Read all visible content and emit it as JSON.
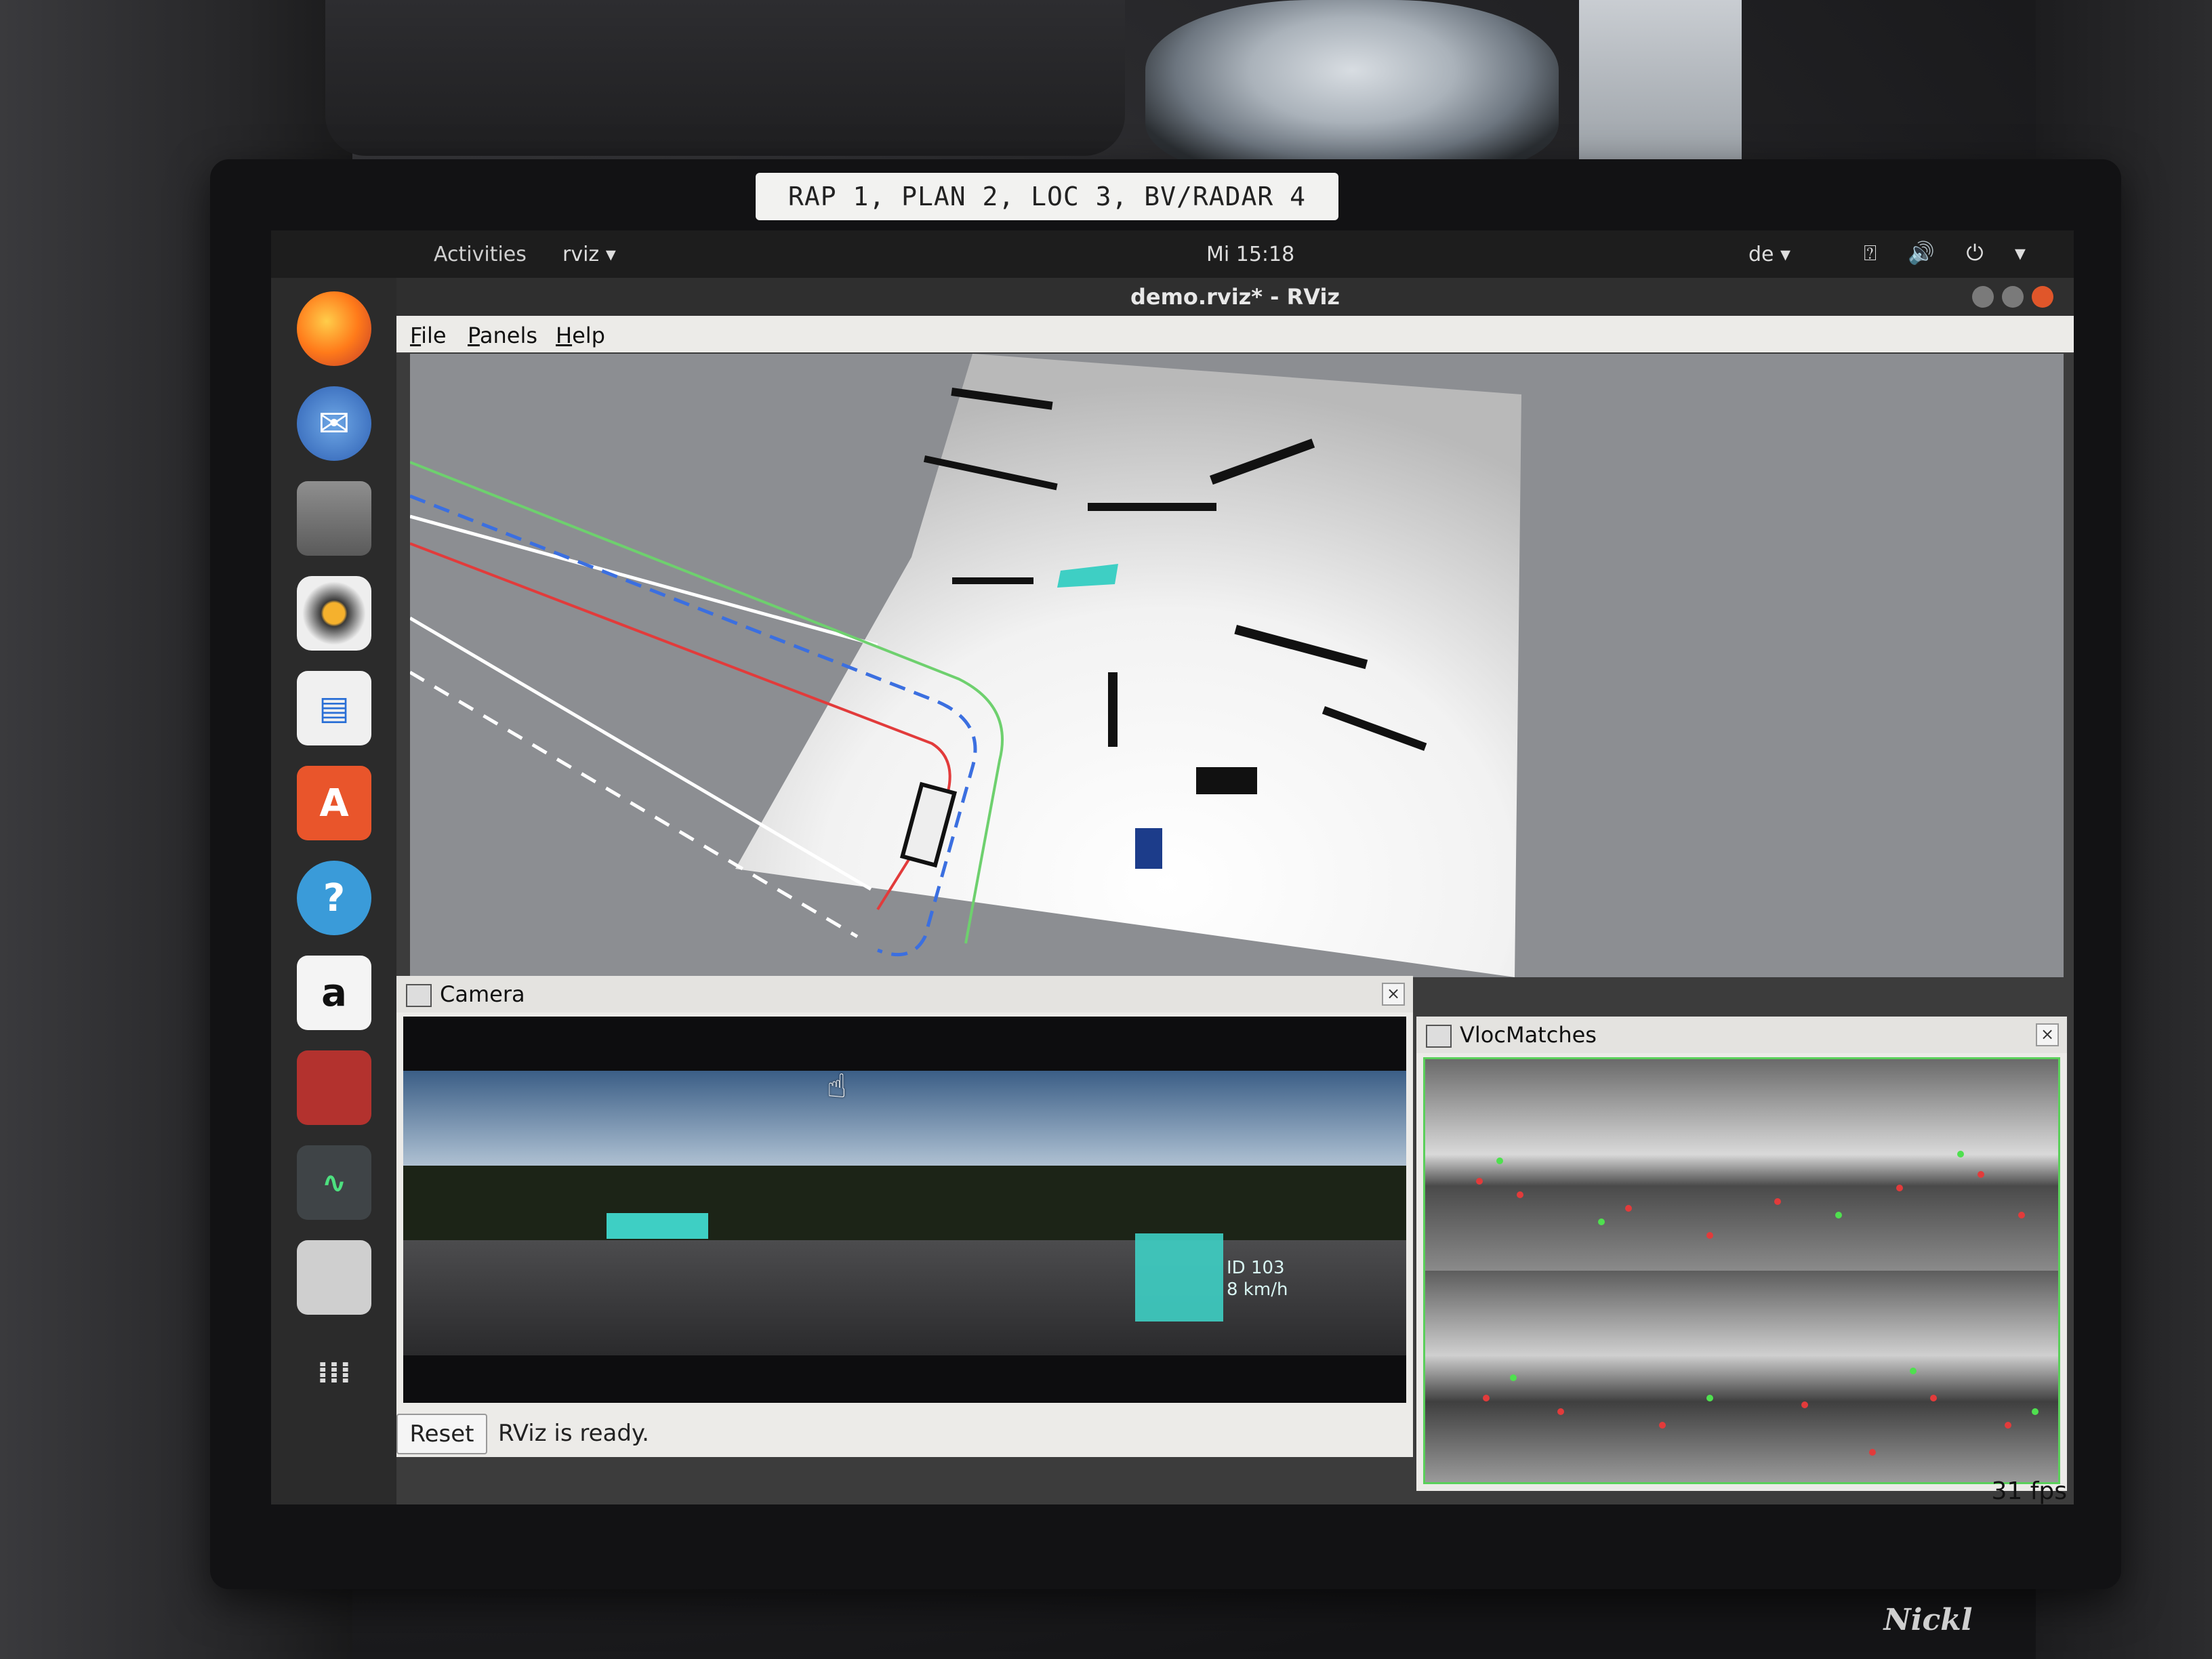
{
  "label": "RAP 1, PLAN 2, LOC 3, BV/RADAR 4",
  "brand": "Nickl",
  "topbar": {
    "activities": "Activities",
    "app_menu": "rviz ▾",
    "clock": "Mi 15:18",
    "language": "de ▾",
    "system_icons": "⍰ 🔊 ⏻ ▾"
  },
  "window": {
    "title": "demo.rviz* - RViz",
    "menu": [
      "File",
      "Panels",
      "Help"
    ]
  },
  "panels": {
    "camera": {
      "title": "Camera",
      "overlay_id": "ID 103",
      "overlay_speed": "8 km/h"
    },
    "vloc": {
      "title": "VlocMatches"
    }
  },
  "status": {
    "reset_label": "Reset",
    "message": "RViz is ready.",
    "fps": "31 fps"
  },
  "colors": {
    "accent_cyan": "#3ecfc4",
    "lane_green": "#6ed06e",
    "lane_blue": "#3b6fe0",
    "lane_red": "#e23b3b"
  },
  "dock_icons": [
    "firefox-icon",
    "thunderbird-icon",
    "files-icon",
    "rhythmbox-icon",
    "writer-icon",
    "software-icon",
    "help-icon",
    "amazon-icon",
    "tool-icon",
    "monitor-icon",
    "trash-icon",
    "apps-grid-icon"
  ]
}
